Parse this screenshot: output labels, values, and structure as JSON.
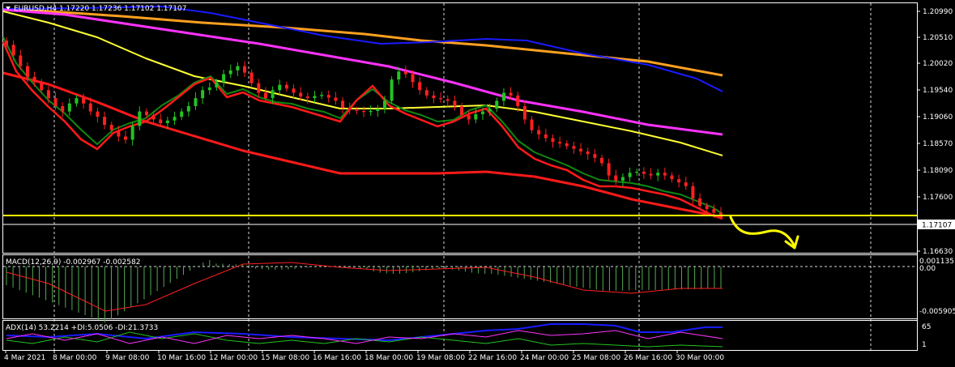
{
  "main_header": "EURUSD,H4  1.17220 1.17236 1.17102 1.17107",
  "current_price_label": "1.17107",
  "price_ticks": [
    "1.20990",
    "1.20510",
    "1.20020",
    "1.19540",
    "1.19060",
    "1.18570",
    "1.18090",
    "1.17600",
    "1.16630"
  ],
  "macd": {
    "label": "MACD(12,26,9) -0.002967 -0.002582",
    "ticks": [
      "0.001135",
      "0.00",
      "-0.005905"
    ]
  },
  "adx": {
    "label": "ADX(14) 53.2214 +DI:5.0506 -DI:21.3733",
    "ticks": [
      "65",
      "1"
    ]
  },
  "time_labels": [
    "4 Mar 2021",
    "8 Mar 00:00",
    "9 Mar 08:00",
    "10 Mar 16:00",
    "12 Mar 00:00",
    "15 Mar 08:00",
    "16 Mar 16:00",
    "18 Mar 00:00",
    "19 Mar 08:00",
    "22 Mar 16:00",
    "24 Mar 00:00",
    "25 Mar 08:00",
    "26 Mar 16:00",
    "30 Mar 00:00"
  ],
  "colors": {
    "background": "#000000",
    "bull_candle": "#22c322",
    "bear_candle": "#ff2020",
    "ma_fast": "#ff1a1a",
    "ma_signal": "#118811",
    "ma_mid": "#ffff33",
    "ma_slow": "#ff33ff",
    "ma_long_a": "#1a1aff",
    "ma_long_b": "#ffa020",
    "ma_base_red": "#ff1a1a",
    "horizontal_line": "#ffff00",
    "arrow": "#ffff00",
    "macd_hist": "#55aa55",
    "macd_signal": "#ff2020",
    "adx_main": "#1a1aff",
    "adx_plus_di": "#22c322",
    "adx_minus_di": "#ff33ff"
  },
  "chart_data": {
    "type": "candlestick",
    "symbol": "EURUSD",
    "timeframe": "H4",
    "ohlc_last": {
      "open": 1.1722,
      "high": 1.17236,
      "low": 1.17102,
      "close": 1.17107
    },
    "ylim": [
      1.164,
      1.2108
    ],
    "horizontal_level": 1.1721,
    "closes": [
      1.203,
      1.201,
      1.199,
      1.197,
      1.196,
      1.1945,
      1.193,
      1.1915,
      1.1905,
      1.192,
      1.193,
      1.192,
      1.1905,
      1.1895,
      1.188,
      1.187,
      1.1858,
      1.1852,
      1.1878,
      1.1905,
      1.1898,
      1.189,
      1.1883,
      1.1888,
      1.1895,
      1.1905,
      1.1915,
      1.193,
      1.1945,
      1.195,
      1.196,
      1.1975,
      1.1982,
      1.199,
      1.1978,
      1.1958,
      1.194,
      1.193,
      1.1945,
      1.1955,
      1.1948,
      1.194,
      1.1933,
      1.193,
      1.1934,
      1.1936,
      1.1931,
      1.1925,
      1.1912,
      1.1908,
      1.1906,
      1.1904,
      1.1906,
      1.191,
      1.1925,
      1.1965,
      1.198,
      1.1975,
      1.196,
      1.1945,
      1.1935,
      1.193,
      1.1928,
      1.1925,
      1.1915,
      1.1898,
      1.189,
      1.19,
      1.1905,
      1.191,
      1.1925,
      1.194,
      1.1935,
      1.1915,
      1.189,
      1.187,
      1.1862,
      1.1855,
      1.1848,
      1.1845,
      1.184,
      1.1835,
      1.183,
      1.1825,
      1.1818,
      1.1808,
      1.1785,
      1.1775,
      1.1782,
      1.179,
      1.1792,
      1.1788,
      1.1785,
      1.179,
      1.1785,
      1.1778,
      1.1772,
      1.1765,
      1.1742,
      1.1728,
      1.1722,
      1.1715,
      1.17107
    ]
  }
}
